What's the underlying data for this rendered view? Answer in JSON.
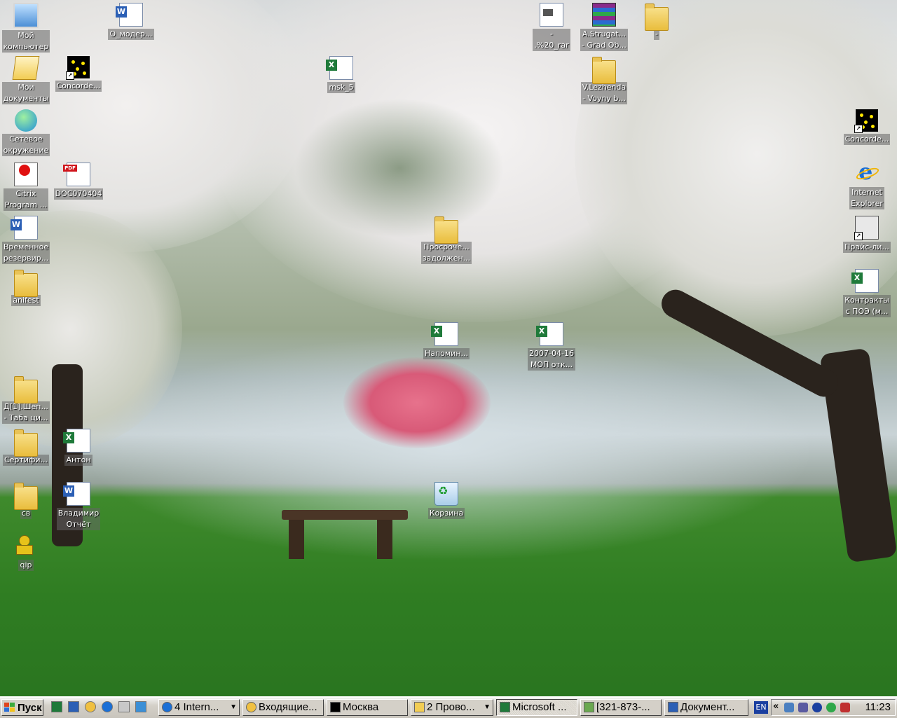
{
  "desktop": {
    "icons": {
      "my_computer": "Мой\nкомпьютер",
      "my_documents": "Мои\nдокументы",
      "network": "Сетевое\nокружение",
      "citrix": "Citrix\nProgram ...",
      "temp_backup": "Временное\nрезервир...",
      "anifest": "anifest",
      "d1_shep": "Д[1].Шеп...\n- Таба ци...",
      "certifi": "Сертифи...",
      "sv": "св",
      "qip": "qip",
      "o_moder": "О_модер...",
      "concorde_left": "Concorde...",
      "doc070404": "DOC070404",
      "anton": "Антон",
      "vladimir": "Владимир\nОтчёт",
      "msk5": "msk_5",
      "prosroch": "Просроче...\nзадолжен...",
      "napomin": "Напомин...",
      "korzina": "Корзина",
      "mop": "2007-04-16\nМОП отк...",
      "rar_file": "-\n.%20_rar",
      "strugat": "A.Strugat...\n- Grad Ob...",
      "dash_folder": "-",
      "lezhenda": "V.Lezhenda\n- Voyny b...",
      "concorde_right": "Concorde...",
      "ie": "Internet\nExplorer",
      "price": "Прайс-ли...",
      "contracts": "Контракты\nс ПОЭ (м..."
    }
  },
  "taskbar": {
    "start_label": "Пуск",
    "tasks": [
      "4 Intern...",
      "Входящие...",
      "Москва",
      "2 Прово...",
      "Microsoft ...",
      "[321-873-...",
      "Документ..."
    ],
    "language": "EN",
    "tray_expand": "«",
    "clock": "11:23"
  },
  "colors": {
    "taskbar_bg": "#d4d0c8",
    "grass": "#2f7d22"
  }
}
